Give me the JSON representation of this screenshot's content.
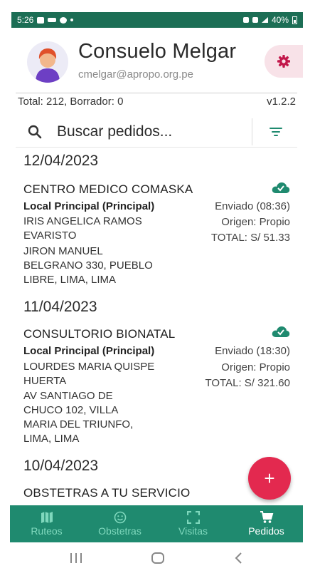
{
  "status_bar": {
    "time": "5:26",
    "battery": "40%"
  },
  "header": {
    "user_name": "Consuelo Melgar",
    "user_email": "cmelgar@apropo.org.pe",
    "totals": "Total: 212, Borrador: 0",
    "version": "v1.2.2"
  },
  "search": {
    "placeholder": "Buscar pedidos..."
  },
  "colors": {
    "primary": "#1f8a6f",
    "accent": "#e3294f",
    "settings_bg": "#f8e2e8"
  },
  "groups": [
    {
      "date": "12/04/2023",
      "orders": [
        {
          "client": "CENTRO MEDICO COMASKA",
          "local": "Local Principal (Principal)",
          "status": "Enviado (08:36)",
          "contact": "IRIS ANGELICA RAMOS\nEVARISTO",
          "origin": "Origen: Propio",
          "total": "TOTAL: S/ 51.33",
          "address": "JIRON MANUEL\nBELGRANO 330, PUEBLO\nLIBRE, LIMA, LIMA",
          "sync_icon": "cloud-check-icon"
        }
      ]
    },
    {
      "date": "11/04/2023",
      "orders": [
        {
          "client": "CONSULTORIO BIONATAL",
          "local": "Local Principal (Principal)",
          "status": "Enviado (18:30)",
          "contact": "LOURDES MARIA  QUISPE\nHUERTA",
          "origin": "Origen: Propio",
          "total": "TOTAL: S/ 321.60",
          "address": "AV SANTIAGO DE\nCHUCO 102, VILLA\nMARIA DEL TRIUNFO,\nLIMA, LIMA",
          "sync_icon": "cloud-check-icon"
        }
      ]
    },
    {
      "date": "10/04/2023",
      "orders": [
        {
          "client": "OBSTETRAS A TU SERVICIO"
        }
      ]
    }
  ],
  "fab": {
    "label": "+"
  },
  "nav": [
    {
      "label": "Ruteos",
      "icon": "map-icon",
      "active": false
    },
    {
      "label": "Obstetras",
      "icon": "smiley-icon",
      "active": false
    },
    {
      "label": "Visitas",
      "icon": "scan-frame-icon",
      "active": false
    },
    {
      "label": "Pedidos",
      "icon": "cart-icon",
      "active": true
    }
  ]
}
